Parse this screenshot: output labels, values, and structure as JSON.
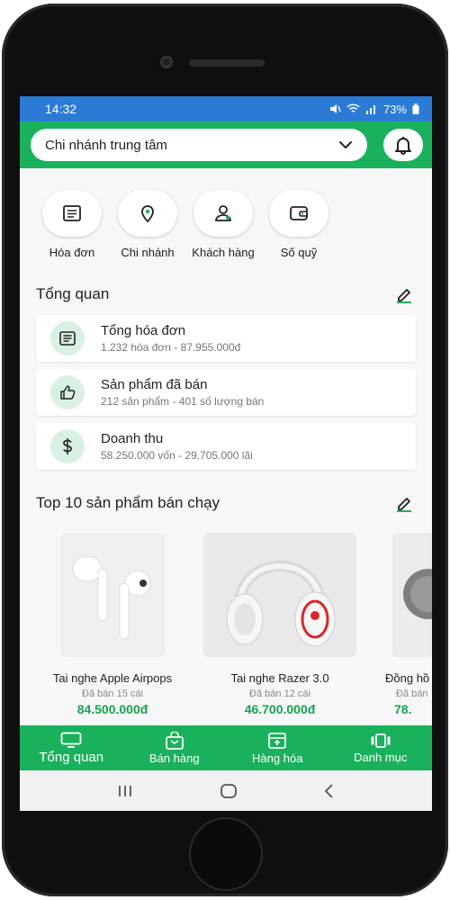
{
  "status_bar": {
    "time": "14:32",
    "battery": "73%"
  },
  "header": {
    "branch": "Chi nhánh trung tâm"
  },
  "quick_actions": [
    {
      "label": "Hóa đơn",
      "icon": "invoice-icon"
    },
    {
      "label": "Chi nhánh",
      "icon": "location-pin-icon"
    },
    {
      "label": "Khách hàng",
      "icon": "user-icon"
    },
    {
      "label": "Số quỹ",
      "icon": "wallet-icon"
    }
  ],
  "overview": {
    "title": "Tổng quan",
    "cards": [
      {
        "title": "Tổng hóa đơn",
        "subtitle": "1.232 hóa đơn - 87.955.000đ",
        "icon": "invoice-icon"
      },
      {
        "title": "Sản phẩm đã bán",
        "subtitle": "212 sản phẩm - 401 số lượng bán",
        "icon": "thumbs-up-icon"
      },
      {
        "title": "Doanh thu",
        "subtitle": "58.250.000 vốn - 29.705.000 lãi",
        "icon": "dollar-icon"
      }
    ]
  },
  "top_products": {
    "title": "Top 10 sản phẩm bán chạy",
    "items": [
      {
        "name": "Tai nghe Apple Airpops",
        "sold": "Đã bán 15 cái",
        "price": "84.500.000đ"
      },
      {
        "name": "Tai nghe Razer 3.0",
        "sold": "Đã bán 12 cái",
        "price": "46.700.000đ"
      },
      {
        "name": "Đồng hồ",
        "sold": "Đã bán",
        "price": "78."
      }
    ]
  },
  "bottom_nav": [
    {
      "label": "Tổng quan",
      "icon": "monitor-icon"
    },
    {
      "label": "Bán hàng",
      "icon": "shopping-bag-icon"
    },
    {
      "label": "Hàng hóa",
      "icon": "box-icon"
    },
    {
      "label": "Danh mục",
      "icon": "categories-icon"
    }
  ],
  "colors": {
    "primary": "#1ab15c",
    "status_bar": "#2b7bd6",
    "price": "#17a24f"
  }
}
